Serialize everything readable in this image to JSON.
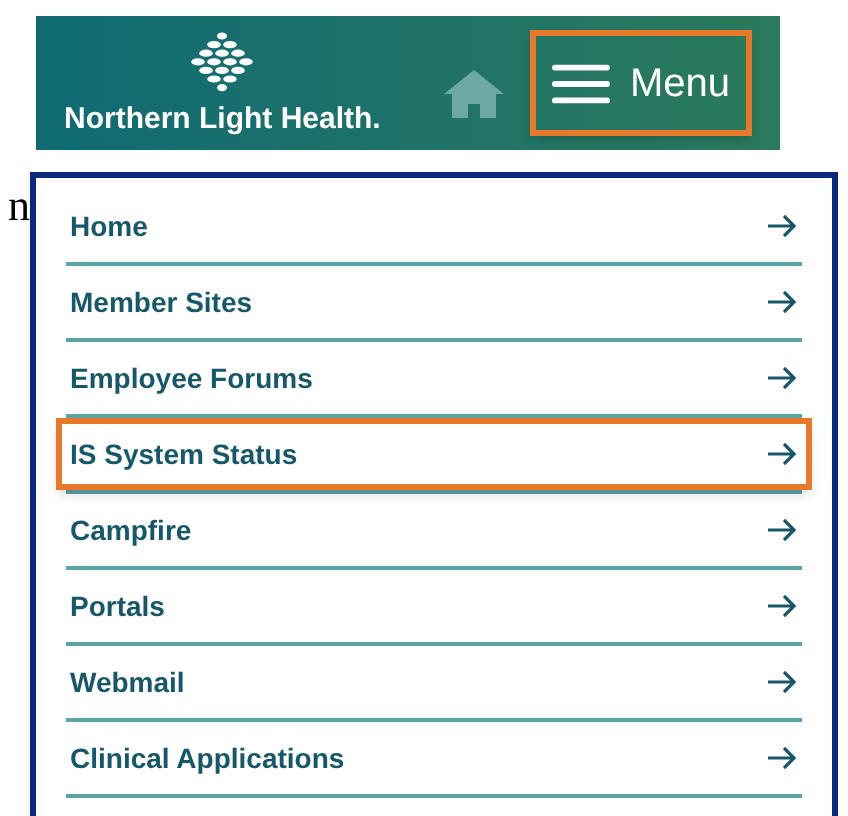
{
  "header": {
    "logo_text": "Northern Light Health.",
    "menu_button": {
      "label": "Menu",
      "highlighted": true
    }
  },
  "side_text": "n",
  "menu_items": [
    {
      "label": "Home",
      "highlighted": false
    },
    {
      "label": "Member Sites",
      "highlighted": false
    },
    {
      "label": "Employee Forums",
      "highlighted": false
    },
    {
      "label": "IS System Status",
      "highlighted": true
    },
    {
      "label": "Campfire",
      "highlighted": false
    },
    {
      "label": "Portals",
      "highlighted": false
    },
    {
      "label": "Webmail",
      "highlighted": false
    },
    {
      "label": "Clinical Applications",
      "highlighted": false
    }
  ]
}
